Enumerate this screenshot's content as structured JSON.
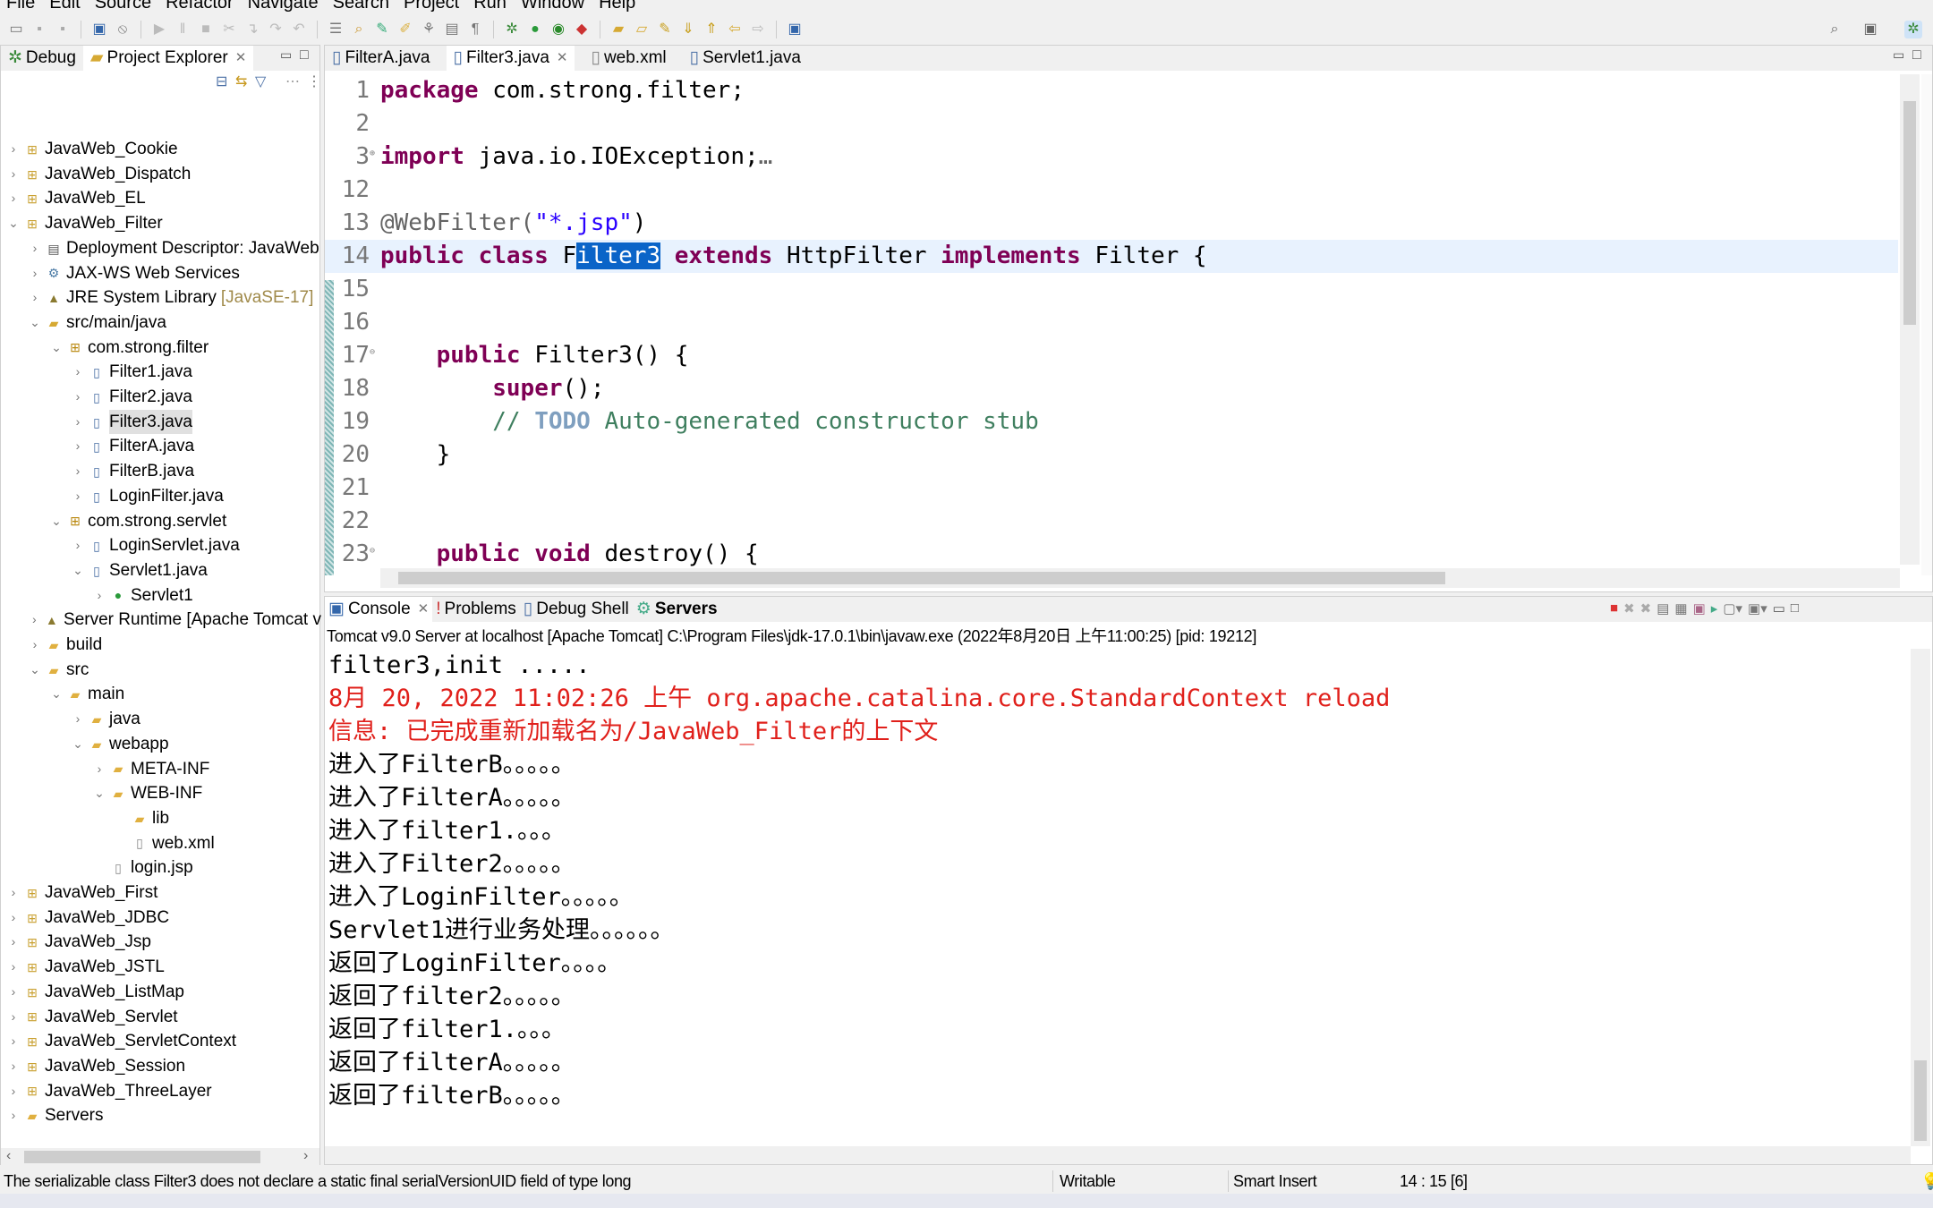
{
  "menu": [
    "File",
    "Edit",
    "Source",
    "Refactor",
    "Navigate",
    "Search",
    "Project",
    "Run",
    "Window",
    "Help"
  ],
  "left_panel": {
    "tabs": [
      {
        "label": "Debug",
        "icon": "bug-icon"
      },
      {
        "label": "Project Explorer",
        "icon": "folder-icon",
        "active": true
      }
    ],
    "tree": [
      {
        "label": "JavaWeb_Cookie",
        "level": 0,
        "state": "collapsed",
        "icon": "project"
      },
      {
        "label": "JavaWeb_Dispatch",
        "level": 0,
        "state": "collapsed",
        "icon": "project"
      },
      {
        "label": "JavaWeb_EL",
        "level": 0,
        "state": "collapsed",
        "icon": "project"
      },
      {
        "label": "JavaWeb_Filter",
        "level": 0,
        "state": "expanded",
        "icon": "project"
      },
      {
        "label": "Deployment Descriptor: JavaWeb",
        "level": 1,
        "state": "collapsed",
        "icon": "descriptor"
      },
      {
        "label": "JAX-WS Web Services",
        "level": 1,
        "state": "collapsed",
        "icon": "webservice"
      },
      {
        "label": "JRE System Library",
        "decoration": "[JavaSE-17]",
        "level": 1,
        "state": "collapsed",
        "icon": "library"
      },
      {
        "label": "src/main/java",
        "level": 1,
        "state": "expanded",
        "icon": "source-folder"
      },
      {
        "label": "com.strong.filter",
        "level": 2,
        "state": "expanded",
        "icon": "package"
      },
      {
        "label": "Filter1.java",
        "level": 3,
        "state": "collapsed",
        "icon": "java-file"
      },
      {
        "label": "Filter2.java",
        "level": 3,
        "state": "collapsed",
        "icon": "java-file"
      },
      {
        "label": "Filter3.java",
        "level": 3,
        "state": "collapsed",
        "icon": "java-file",
        "selected": true
      },
      {
        "label": "FilterA.java",
        "level": 3,
        "state": "collapsed",
        "icon": "java-file"
      },
      {
        "label": "FilterB.java",
        "level": 3,
        "state": "collapsed",
        "icon": "java-file"
      },
      {
        "label": "LoginFilter.java",
        "level": 3,
        "state": "collapsed",
        "icon": "java-file"
      },
      {
        "label": "com.strong.servlet",
        "level": 2,
        "state": "expanded",
        "icon": "package"
      },
      {
        "label": "LoginServlet.java",
        "level": 3,
        "state": "collapsed",
        "icon": "java-file"
      },
      {
        "label": "Servlet1.java",
        "level": 3,
        "state": "expanded",
        "icon": "java-file"
      },
      {
        "label": "Servlet1",
        "level": 4,
        "state": "collapsed",
        "icon": "class"
      },
      {
        "label": "Server Runtime [Apache Tomcat v",
        "level": 1,
        "state": "collapsed",
        "icon": "library"
      },
      {
        "label": "build",
        "level": 1,
        "state": "collapsed",
        "icon": "folder"
      },
      {
        "label": "src",
        "level": 1,
        "state": "expanded",
        "icon": "folder"
      },
      {
        "label": "main",
        "level": 2,
        "state": "expanded",
        "icon": "folder"
      },
      {
        "label": "java",
        "level": 3,
        "state": "collapsed",
        "icon": "folder"
      },
      {
        "label": "webapp",
        "level": 3,
        "state": "expanded",
        "icon": "folder"
      },
      {
        "label": "META-INF",
        "level": 4,
        "state": "collapsed",
        "icon": "folder"
      },
      {
        "label": "WEB-INF",
        "level": 4,
        "state": "expanded",
        "icon": "folder"
      },
      {
        "label": "lib",
        "level": 5,
        "state": "leaf",
        "icon": "folder"
      },
      {
        "label": "web.xml",
        "level": 5,
        "state": "leaf",
        "icon": "xml-file"
      },
      {
        "label": "login.jsp",
        "level": 4,
        "state": "leaf",
        "icon": "jsp-file"
      },
      {
        "label": "JavaWeb_First",
        "level": 0,
        "state": "collapsed",
        "icon": "project"
      },
      {
        "label": "JavaWeb_JDBC",
        "level": 0,
        "state": "collapsed",
        "icon": "project"
      },
      {
        "label": "JavaWeb_Jsp",
        "level": 0,
        "state": "collapsed",
        "icon": "project"
      },
      {
        "label": "JavaWeb_JSTL",
        "level": 0,
        "state": "collapsed",
        "icon": "project"
      },
      {
        "label": "JavaWeb_ListMap",
        "level": 0,
        "state": "collapsed",
        "icon": "project"
      },
      {
        "label": "JavaWeb_Servlet",
        "level": 0,
        "state": "collapsed",
        "icon": "project"
      },
      {
        "label": "JavaWeb_ServletContext",
        "level": 0,
        "state": "collapsed",
        "icon": "project"
      },
      {
        "label": "JavaWeb_Session",
        "level": 0,
        "state": "collapsed",
        "icon": "project"
      },
      {
        "label": "JavaWeb_ThreeLayer",
        "level": 0,
        "state": "collapsed",
        "icon": "project"
      },
      {
        "label": "Servers",
        "level": 0,
        "state": "collapsed",
        "icon": "folder"
      }
    ]
  },
  "editor": {
    "tabs": [
      {
        "label": "FilterA.java"
      },
      {
        "label": "Filter3.java",
        "active": true
      },
      {
        "label": "web.xml"
      },
      {
        "label": "Servlet1.java"
      }
    ],
    "lines": [
      {
        "num": "1",
        "segs": [
          [
            "package",
            "kw"
          ],
          [
            " com.strong.filter;",
            ""
          ]
        ]
      },
      {
        "num": "2",
        "segs": []
      },
      {
        "num": "3",
        "fold": "+",
        "segs": [
          [
            "import",
            "kw"
          ],
          [
            " java.io.IOException;",
            ""
          ],
          [
            "…",
            "an"
          ]
        ]
      },
      {
        "num": "12",
        "segs": []
      },
      {
        "num": "13",
        "segs": [
          [
            "@WebFilter(",
            "an"
          ],
          [
            "\"*.jsp\"",
            "st"
          ],
          [
            ")",
            ""
          ]
        ]
      },
      {
        "num": "14",
        "current": true,
        "segs": [
          [
            "public class",
            "kw"
          ],
          [
            " F",
            ""
          ],
          [
            "ilter3",
            "hl"
          ],
          [
            " ",
            ""
          ],
          [
            "extends",
            "kw"
          ],
          [
            " HttpFilter ",
            ""
          ],
          [
            "implements",
            "kw"
          ],
          [
            " Filter {",
            ""
          ]
        ]
      },
      {
        "num": "15",
        "segs": []
      },
      {
        "num": "16",
        "segs": []
      },
      {
        "num": "17",
        "fold": "-",
        "segs": [
          [
            "    ",
            ""
          ],
          [
            "public",
            "kw"
          ],
          [
            " Filter3() {",
            ""
          ]
        ]
      },
      {
        "num": "18",
        "segs": [
          [
            "        ",
            ""
          ],
          [
            "super",
            "kw"
          ],
          [
            "();",
            ""
          ]
        ]
      },
      {
        "num": "19",
        "segs": [
          [
            "        ",
            ""
          ],
          [
            "// ",
            "cm"
          ],
          [
            "TODO",
            "td"
          ],
          [
            " Auto-generated constructor stub",
            "cm"
          ]
        ]
      },
      {
        "num": "20",
        "segs": [
          [
            "    }",
            ""
          ]
        ]
      },
      {
        "num": "21",
        "segs": []
      },
      {
        "num": "22",
        "segs": []
      },
      {
        "num": "23",
        "fold": "-",
        "segs": [
          [
            "    ",
            ""
          ],
          [
            "public void",
            "kw"
          ],
          [
            " destroy() {",
            ""
          ]
        ]
      }
    ]
  },
  "console": {
    "tabs": [
      {
        "label": "Console",
        "active": true
      },
      {
        "label": "Problems"
      },
      {
        "label": "Debug Shell"
      },
      {
        "label": "Servers",
        "bold": true
      }
    ],
    "header": "Tomcat v9.0 Server at localhost [Apache Tomcat] C:\\Program Files\\jdk-17.0.1\\bin\\javaw.exe  (2022年8月20日 上午11:00:25) [pid: 19212]",
    "output": [
      {
        "text": "filter3,init .....",
        "type": "out"
      },
      {
        "text": "8月 20, 2022 11:02:26 上午 org.apache.catalina.core.StandardContext reload",
        "type": "err"
      },
      {
        "text": "信息: 已完成重新加载名为/JavaWeb_Filter的上下文",
        "type": "err"
      },
      {
        "text": "进入了FilterB。。。。。",
        "type": "out"
      },
      {
        "text": "进入了FilterA。。。。。",
        "type": "out"
      },
      {
        "text": "进入了filter1.。。。",
        "type": "out"
      },
      {
        "text": "进入了Filter2。。。。。",
        "type": "out"
      },
      {
        "text": "进入了LoginFilter。。。。。",
        "type": "out"
      },
      {
        "text": "Servlet1进行业务处理。。。。。。",
        "type": "out"
      },
      {
        "text": "返回了LoginFilter。。。。",
        "type": "out"
      },
      {
        "text": "返回了filter2。。。。。",
        "type": "out"
      },
      {
        "text": "返回了filter1.。。。",
        "type": "out"
      },
      {
        "text": "返回了filterA。。。。。",
        "type": "out"
      },
      {
        "text": "返回了filterB。。。。。",
        "type": "out"
      }
    ]
  },
  "status": {
    "message": "The serializable class Filter3 does not declare a static final serialVersionUID field of type long",
    "writable": "Writable",
    "insert_mode": "Smart Insert",
    "position": "14 : 15 [6]"
  },
  "colors": {
    "keyword": "#7f0055",
    "string": "#2a00ff",
    "comment": "#3f7f5f",
    "error_output": "#e0201b",
    "selection": "#0a64c8",
    "current_line": "#e8f2fe"
  }
}
